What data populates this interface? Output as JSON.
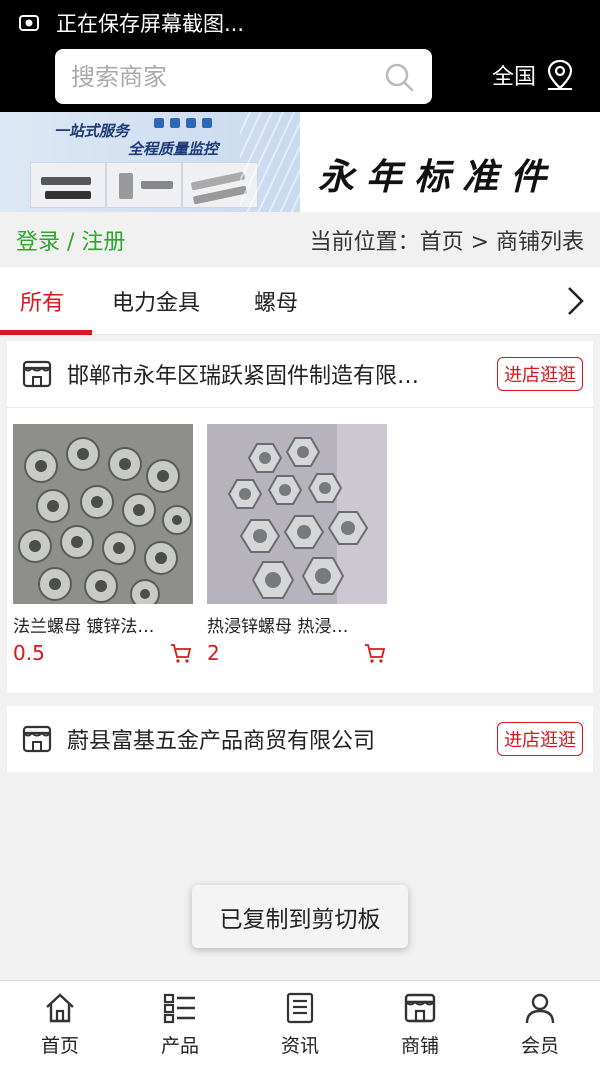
{
  "status_bar": {
    "text": "正在保存屏幕截图..."
  },
  "header": {
    "search_placeholder": "搜索商家",
    "region_label": "全国"
  },
  "banner": {
    "slogan_line1": "一站式服务",
    "slogan_line2": "全程质量监控",
    "brand_name": "永年标准件"
  },
  "crumb_bar": {
    "login_label": "登录 / 注册",
    "breadcrumb": "当前位置：首页 > 商铺列表"
  },
  "tabs": [
    {
      "label": "所有",
      "active": true
    },
    {
      "label": "电力金具",
      "active": false
    },
    {
      "label": "螺母",
      "active": false
    }
  ],
  "shops": [
    {
      "name": "邯郸市永年区瑞跃紧固件制造有限…",
      "button_label": "进店逛逛",
      "products": [
        {
          "name": "法兰螺母 镀锌法…",
          "price": "0.5"
        },
        {
          "name": "热浸锌螺母 热浸…",
          "price": "2"
        }
      ]
    },
    {
      "name": "蔚县富基五金产品商贸有限公司",
      "button_label": "进店逛逛",
      "products": []
    }
  ],
  "toast": {
    "text": "已复制到剪切板"
  },
  "bottom_nav": [
    {
      "label": "首页",
      "icon": "home-icon"
    },
    {
      "label": "产品",
      "icon": "list-icon"
    },
    {
      "label": "资讯",
      "icon": "news-icon"
    },
    {
      "label": "商铺",
      "icon": "store-icon"
    },
    {
      "label": "会员",
      "icon": "user-icon"
    }
  ],
  "colors": {
    "accent": "#d9171e",
    "login_green": "#2ea52e",
    "top_bar": "#000000"
  }
}
